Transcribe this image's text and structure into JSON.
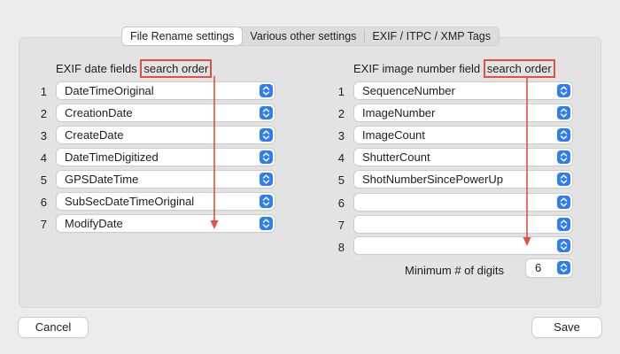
{
  "tabs": [
    {
      "label": "File Rename settings",
      "selected": true
    },
    {
      "label": "Various other settings",
      "selected": false
    },
    {
      "label": "EXIF / ITPC / XMP Tags",
      "selected": false
    }
  ],
  "left": {
    "header_prefix": "EXIF date fields ",
    "header_highlight": "search order",
    "rows": [
      {
        "num": "1",
        "value": "DateTimeOriginal"
      },
      {
        "num": "2",
        "value": "CreationDate"
      },
      {
        "num": "3",
        "value": "CreateDate"
      },
      {
        "num": "4",
        "value": "DateTimeDigitized"
      },
      {
        "num": "5",
        "value": "GPSDateTime"
      },
      {
        "num": "6",
        "value": "SubSecDateTimeOriginal"
      },
      {
        "num": "7",
        "value": "ModifyDate"
      }
    ]
  },
  "right": {
    "header_prefix": "EXIF image number field ",
    "header_highlight": "search order",
    "rows": [
      {
        "num": "1",
        "value": "SequenceNumber"
      },
      {
        "num": "2",
        "value": "ImageNumber"
      },
      {
        "num": "3",
        "value": "ImageCount"
      },
      {
        "num": "4",
        "value": "ShutterCount"
      },
      {
        "num": "5",
        "value": "ShotNumberSincePowerUp"
      },
      {
        "num": "6",
        "value": ""
      },
      {
        "num": "7",
        "value": ""
      },
      {
        "num": "8",
        "value": ""
      }
    ]
  },
  "min_digits": {
    "label": "Minimum # of digits",
    "value": "6"
  },
  "buttons": {
    "cancel": "Cancel",
    "save": "Save"
  },
  "colors": {
    "accent": "#2e7cf6",
    "highlight": "#e15043"
  },
  "icons": {
    "stepper": "up-down-chevron-icon",
    "arrow": "arrow-down-icon"
  }
}
